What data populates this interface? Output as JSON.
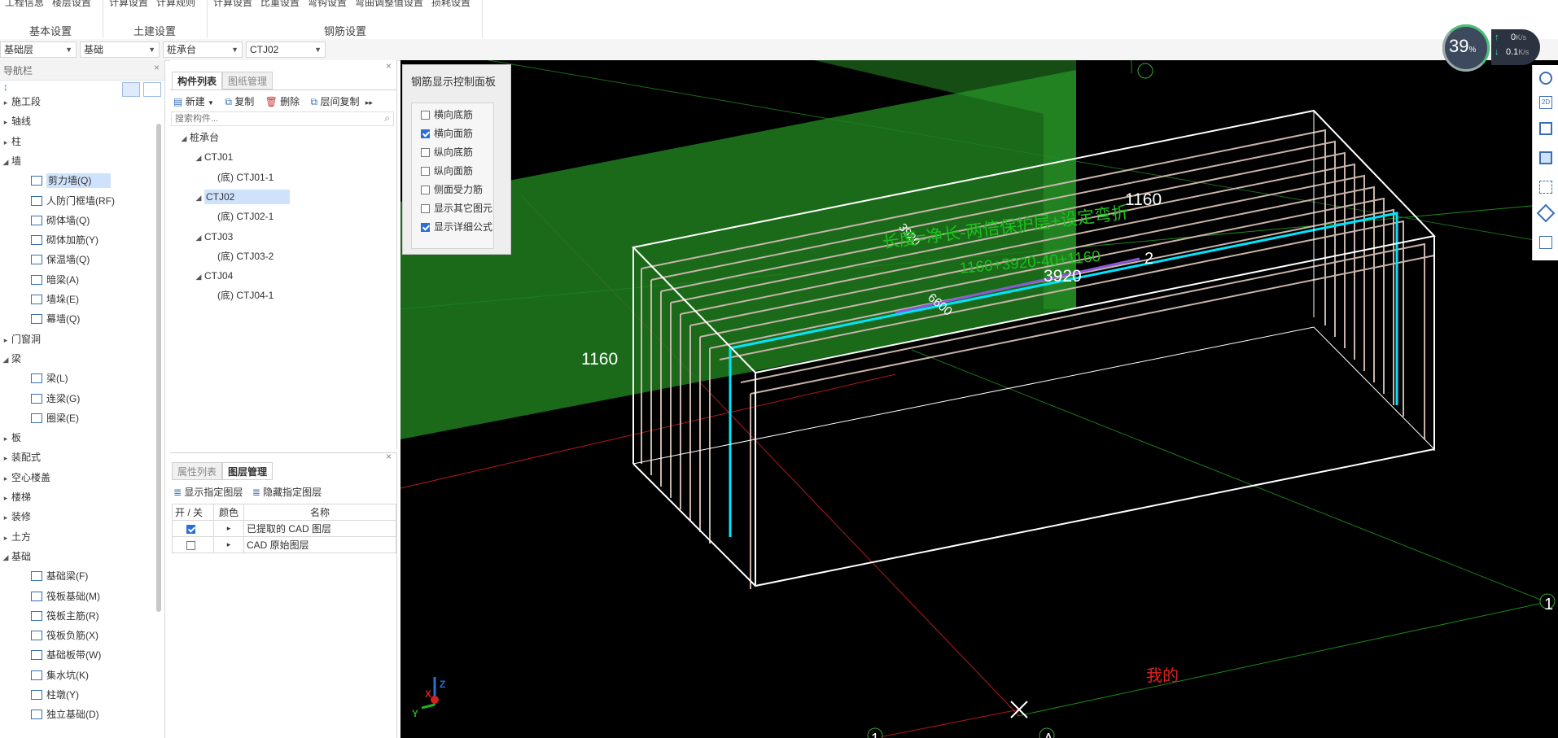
{
  "ribbon": {
    "top_items": [
      "工程信息",
      "楼层设置",
      "计算设置",
      "计算规则",
      "计算设置",
      "比重设置",
      "弯钩设置",
      "弯曲调整值设置",
      "损耗设置"
    ],
    "groups": [
      "基本设置",
      "土建设置",
      "钢筋设置"
    ]
  },
  "selectors": [
    {
      "value": "基础层"
    },
    {
      "value": "基础"
    },
    {
      "value": "桩承台"
    },
    {
      "value": "CTJ02"
    }
  ],
  "nav": {
    "title": "导航栏",
    "items": [
      {
        "label": "施工段",
        "level": 0,
        "expanded": false
      },
      {
        "label": "轴线",
        "level": 0,
        "expanded": false
      },
      {
        "label": "柱",
        "level": 0,
        "expanded": false
      },
      {
        "label": "墙",
        "level": 0,
        "expanded": true
      },
      {
        "label": "剪力墙(Q)",
        "level": 1,
        "selected": true
      },
      {
        "label": "人防门框墙(RF)",
        "level": 1
      },
      {
        "label": "砌体墙(Q)",
        "level": 1
      },
      {
        "label": "砌体加筋(Y)",
        "level": 1
      },
      {
        "label": "保温墙(Q)",
        "level": 1
      },
      {
        "label": "暗梁(A)",
        "level": 1
      },
      {
        "label": "墙垛(E)",
        "level": 1
      },
      {
        "label": "幕墙(Q)",
        "level": 1
      },
      {
        "label": "门窗洞",
        "level": 0,
        "expanded": false
      },
      {
        "label": "梁",
        "level": 0,
        "expanded": true
      },
      {
        "label": "梁(L)",
        "level": 1
      },
      {
        "label": "连梁(G)",
        "level": 1
      },
      {
        "label": "圈梁(E)",
        "level": 1
      },
      {
        "label": "板",
        "level": 0,
        "expanded": false
      },
      {
        "label": "装配式",
        "level": 0,
        "expanded": false
      },
      {
        "label": "空心楼盖",
        "level": 0,
        "expanded": false
      },
      {
        "label": "楼梯",
        "level": 0,
        "expanded": false
      },
      {
        "label": "装修",
        "level": 0,
        "expanded": false
      },
      {
        "label": "土方",
        "level": 0,
        "expanded": false
      },
      {
        "label": "基础",
        "level": 0,
        "expanded": true
      },
      {
        "label": "基础梁(F)",
        "level": 1
      },
      {
        "label": "筏板基础(M)",
        "level": 1
      },
      {
        "label": "筏板主筋(R)",
        "level": 1
      },
      {
        "label": "筏板负筋(X)",
        "level": 1
      },
      {
        "label": "基础板带(W)",
        "level": 1
      },
      {
        "label": "集水坑(K)",
        "level": 1
      },
      {
        "label": "柱墩(Y)",
        "level": 1
      },
      {
        "label": "独立基础(D)",
        "level": 1
      }
    ]
  },
  "components": {
    "tabs": [
      "构件列表",
      "图纸管理"
    ],
    "toolbar": {
      "new": "新建",
      "copy": "复制",
      "delete": "删除",
      "floor_copy": "层间复制"
    },
    "search_placeholder": "搜索构件...",
    "tree": [
      {
        "label": "桩承台",
        "level": 0
      },
      {
        "label": "CTJ01",
        "level": 1
      },
      {
        "label": "(底)  CTJ01-1",
        "level": 2
      },
      {
        "label": "CTJ02",
        "level": 1,
        "selected": true
      },
      {
        "label": "(底)  CTJ02-1",
        "level": 2
      },
      {
        "label": "CTJ03",
        "level": 1
      },
      {
        "label": "(底)  CTJ03-2",
        "level": 2
      },
      {
        "label": "CTJ04",
        "level": 1
      },
      {
        "label": "(底)  CTJ04-1",
        "level": 2
      }
    ]
  },
  "layers": {
    "tabs": [
      "属性列表",
      "图层管理"
    ],
    "show_btn": "显示指定图层",
    "hide_btn": "隐藏指定图层",
    "headers": [
      "开 / 关",
      "颜色",
      "名称"
    ],
    "rows": [
      {
        "on": true,
        "name": "已提取的 CAD 图层"
      },
      {
        "on": false,
        "name": "CAD 原始图层"
      }
    ]
  },
  "control_panel": {
    "title": "钢筋显示控制面板",
    "options": [
      {
        "label": "横向底筋",
        "checked": false
      },
      {
        "label": "横向面筋",
        "checked": true
      },
      {
        "label": "纵向底筋",
        "checked": false
      },
      {
        "label": "纵向面筋",
        "checked": false
      },
      {
        "label": "侧面受力筋",
        "checked": false
      },
      {
        "label": "显示其它图元",
        "checked": false
      },
      {
        "label": "显示详细公式",
        "checked": true
      }
    ]
  },
  "viewport": {
    "dim_labels": [
      "3920",
      "1160",
      "1160",
      "6600",
      "3920"
    ],
    "formula_line1": "长度=净长-两倍保护层+设定弯折",
    "formula_line2": "1160+3920-40+1160",
    "axis_labels": [
      "2",
      "1",
      "1",
      "A"
    ],
    "red_label": "我的",
    "axes": {
      "x": "X",
      "y": "Y",
      "z": "Z"
    }
  },
  "status_widget": {
    "percent": "39",
    "unit": "%",
    "up": "0",
    "down": "0.1",
    "rate_unit": "K/s"
  },
  "colors": {
    "accent": "#2a6fd6",
    "selected_bg": "#cfe2fb",
    "green_plane": "#1f7a1f",
    "cyan_rebar": "#00e5ff",
    "rebar": "#c8b4aa"
  }
}
